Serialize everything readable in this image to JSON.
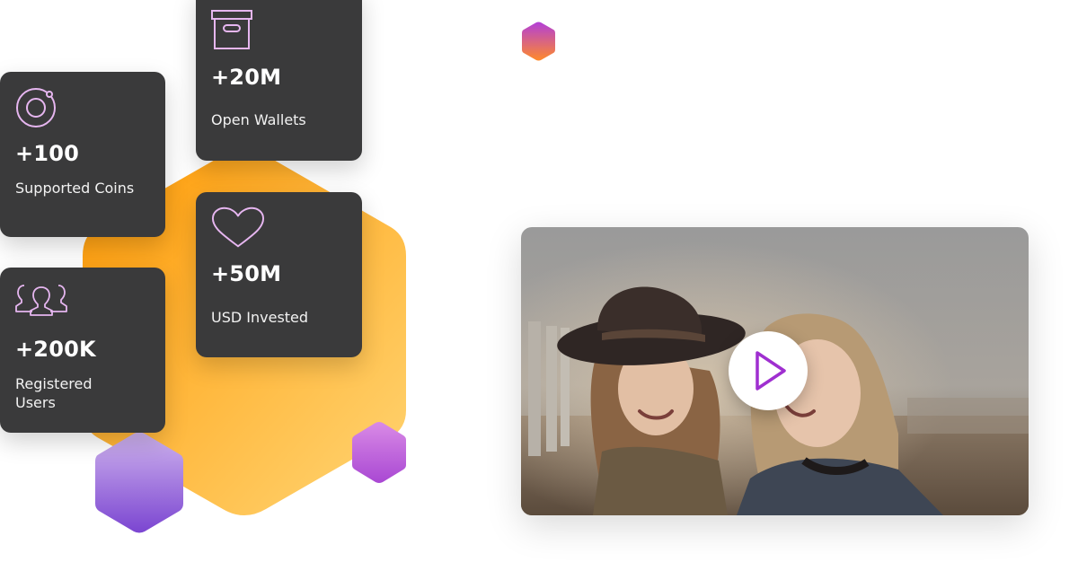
{
  "stats": [
    {
      "icon": "coin-icon",
      "value": "+100",
      "label": "Supported Coins"
    },
    {
      "icon": "wallet-box-icon",
      "value": "+20M",
      "label": "Open Wallets"
    },
    {
      "icon": "heart-icon",
      "value": "+50M",
      "label": "USD Invested"
    },
    {
      "icon": "users-group-icon",
      "value": "+200K",
      "label": "Registered Users"
    }
  ],
  "colors": {
    "card_bg": "#3a3a3b",
    "icon_stroke": "#e6b6f0",
    "hex_orange_start": "#ff9e0f",
    "hex_orange_end": "#ffd36e",
    "hex_purple_start": "#c9a5ea",
    "hex_purple_end": "#7d49d3",
    "play_icon": "#9f2fd0"
  },
  "video": {
    "play_icon": "play-icon"
  }
}
